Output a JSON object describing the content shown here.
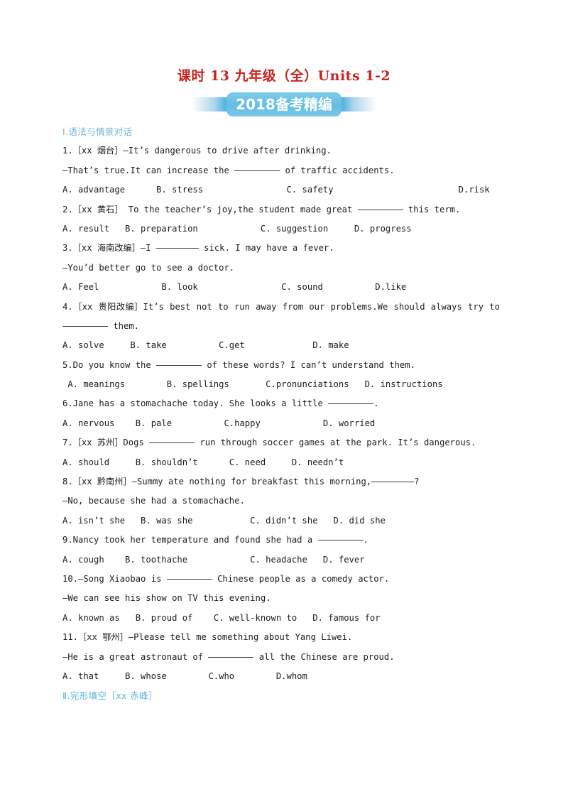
{
  "document": {
    "title": "课时 13 九年级（全）Units 1-2",
    "banner_text": "2018备考精编",
    "colors": {
      "title_red": "#c9241f",
      "banner_blue": "#63bee2",
      "section_teal": "#74b6cd",
      "section_blue": "#5cb4d8",
      "body_text": "#1c1c1c"
    }
  },
  "sections": [
    {
      "id": "section-1",
      "label": "Ⅰ.语法与情景对话"
    },
    {
      "id": "section-2",
      "label": "Ⅱ.完形填空［xx 赤峰］"
    }
  ],
  "lines": [
    {
      "id": "q1-stem",
      "text": "1.［xx 烟台］—It’s dangerous to drive after drinking."
    },
    {
      "id": "q1-reply-a",
      "text": "—That’s true.It can increase the "
    },
    {
      "id": "q1-reply-b",
      "text": " of traffic accidents."
    },
    {
      "id": "q1-options",
      "text": "A. advantage      B. stress                C. safety                        D.risk"
    },
    {
      "id": "q2-stem-a",
      "text": "2.［xx 黄石］ To the teacher’s joy,the student made great "
    },
    {
      "id": "q2-stem-b",
      "text": " this term."
    },
    {
      "id": "q2-options",
      "text": "A. result   B. preparation            C. suggestion     D. progress"
    },
    {
      "id": "q3-stem-a",
      "text": "3.［xx 海南改编］—I "
    },
    {
      "id": "q3-stem-b",
      "text": " sick. I may have a fever."
    },
    {
      "id": "q3-reply",
      "text": "—You’d better go to see a doctor."
    },
    {
      "id": "q3-options",
      "text": "A. Feel            B. look                C. sound          D.like"
    },
    {
      "id": "q4-stem",
      "text": "4.［xx 贵阳改编］It’s best not to run away from our problems.We should always try to"
    },
    {
      "id": "q4-stem-b",
      "text": " them."
    },
    {
      "id": "q4-options",
      "text": "A. solve     B. take          C.get             D. make"
    },
    {
      "id": "q5-stem-a",
      "text": "5.Do you know the "
    },
    {
      "id": "q5-stem-b",
      "text": " of these words? I can’t understand them."
    },
    {
      "id": "q5-options",
      "text": " A. meanings        B. spellings       C.pronunciations   D. instructions"
    },
    {
      "id": "q6-stem-a",
      "text": "6.Jane has a stomachache today. She looks a little "
    },
    {
      "id": "q6-stem-b",
      "text": "."
    },
    {
      "id": "q6-options",
      "text": "A. nervous    B. pale          C.happy            D. worried"
    },
    {
      "id": "q7-stem-a",
      "text": "7.［xx 苏州］Dogs "
    },
    {
      "id": "q7-stem-b",
      "text": " run through soccer games at the park. It’s dangerous."
    },
    {
      "id": "q7-options",
      "text": "A. should     B. shouldn’t      C. need     D. needn’t"
    },
    {
      "id": "q8-stem-a",
      "text": "8.［xx 黔南州］—Summy ate nothing for breakfast this morning,"
    },
    {
      "id": "q8-stem-b",
      "text": "?"
    },
    {
      "id": "q8-reply",
      "text": "—No, because she had a stomachache."
    },
    {
      "id": "q8-options",
      "text": "A. isn’t she   B. was she           C. didn’t she   D. did she"
    },
    {
      "id": "q9-stem-a",
      "text": "9.Nancy took her temperature and found she had a "
    },
    {
      "id": "q9-stem-b",
      "text": "."
    },
    {
      "id": "q9-options",
      "text": "A. cough    B. toothache            C. headache   D. fever"
    },
    {
      "id": "q10-stem-a",
      "text": "10.—Song Xiaobao is "
    },
    {
      "id": "q10-stem-b",
      "text": " Chinese people as a comedy actor."
    },
    {
      "id": "q10-reply",
      "text": "—We can see his show on TV this evening."
    },
    {
      "id": "q10-options",
      "text": "A. known as   B. proud of    C. well-known to   D. famous for"
    },
    {
      "id": "q11-stem",
      "text": "11.［xx 鄂州］—Please tell me something about Yang Liwei."
    },
    {
      "id": "q11-reply-a",
      "text": "—He is a great astronaut of "
    },
    {
      "id": "q11-reply-b",
      "text": " all the Chinese are proud."
    },
    {
      "id": "q11-options",
      "text": "A. that     B. whose        C.who        D.whom"
    }
  ]
}
